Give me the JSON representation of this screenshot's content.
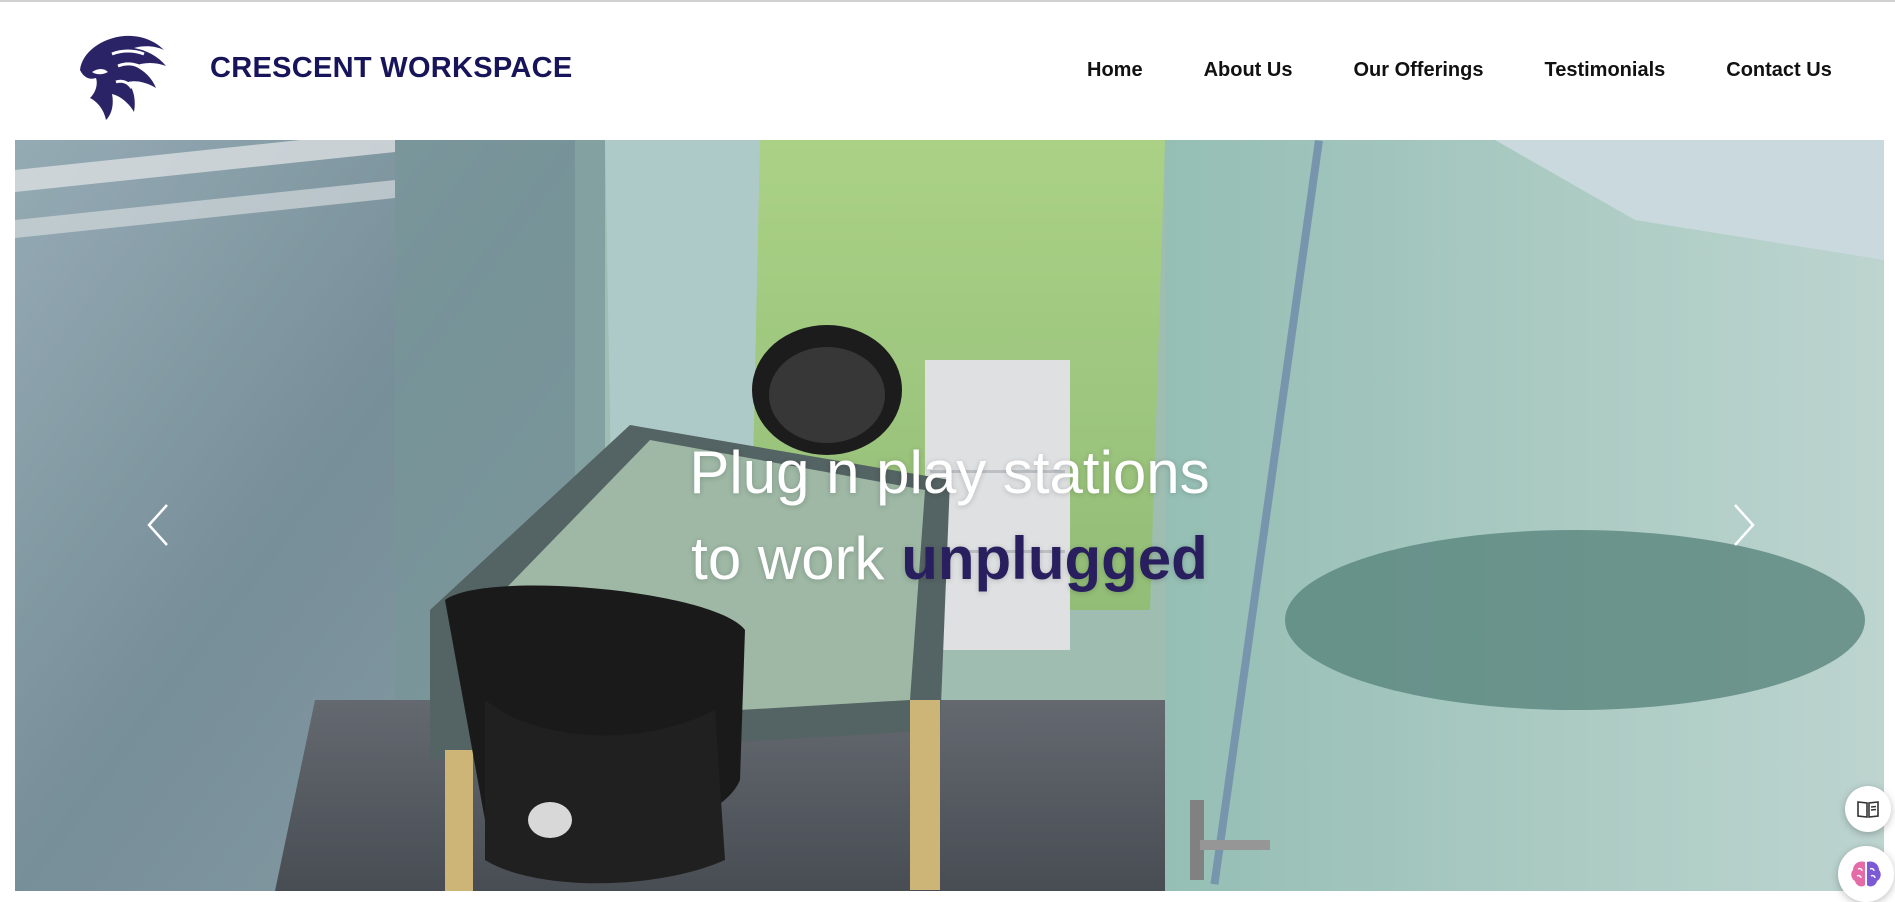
{
  "brand": {
    "name": "CRESCENT WORKSPACE",
    "logo_icon": "lion-head-icon",
    "color": "#17145a"
  },
  "nav": {
    "items": [
      {
        "label": "Home"
      },
      {
        "label": "About Us"
      },
      {
        "label": "Our Offerings"
      },
      {
        "label": "Testimonials"
      },
      {
        "label": "Contact Us"
      }
    ]
  },
  "hero": {
    "line1": "Plug n play stations",
    "line2_prefix": "to work ",
    "line2_emphasis": "unplugged",
    "emphasis_color": "#2a1f5e",
    "prev_icon": "chevron-left-icon",
    "next_icon": "chevron-right-icon"
  },
  "widgets": {
    "reader_icon": "open-book-icon",
    "ai_icon": "brain-icon"
  }
}
